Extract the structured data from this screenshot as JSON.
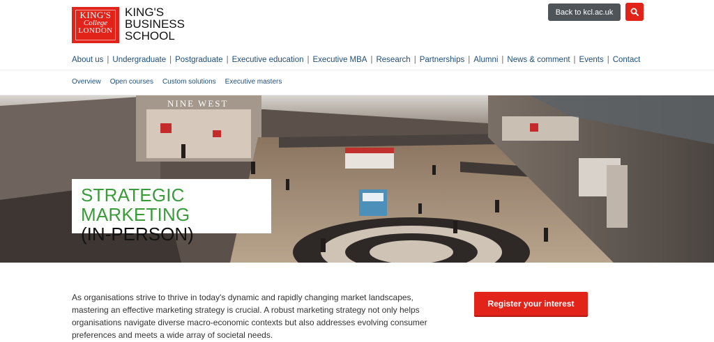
{
  "header": {
    "logo": {
      "line1": "KING'S",
      "line2": "College",
      "line3": "LONDON"
    },
    "school_name": [
      "KING'S",
      "BUSINESS",
      "SCHOOL"
    ],
    "back_label": "Back to kcl.ac.uk",
    "search_icon": "search-icon"
  },
  "main_nav": {
    "items": [
      "About us",
      "Undergraduate",
      "Postgraduate",
      "Executive education",
      "Executive MBA",
      "Research",
      "Partnerships",
      "Alumni",
      "News & comment",
      "Events",
      "Contact"
    ]
  },
  "sub_nav": {
    "items": [
      "Overview",
      "Open courses",
      "Custom solutions",
      "Executive masters"
    ]
  },
  "hero": {
    "title_line1": "STRATEGIC MARKETING",
    "title_line2": "(IN-PERSON)",
    "store_sign": "NINE WEST"
  },
  "content": {
    "intro": "As organisations strive to thrive in today's dynamic and rapidly changing market landscapes, mastering an effective marketing strategy is crucial. A robust marketing strategy not only helps organisations navigate diverse macro-economic contexts but also addresses evolving consumer preferences and meets a wide array of societal needs.",
    "register_label": "Register your interest"
  },
  "colors": {
    "brand_red": "#e2231a",
    "nav_blue": "#1f4f7a",
    "title_green": "#3a9b3a",
    "back_button": "#4f5459"
  }
}
